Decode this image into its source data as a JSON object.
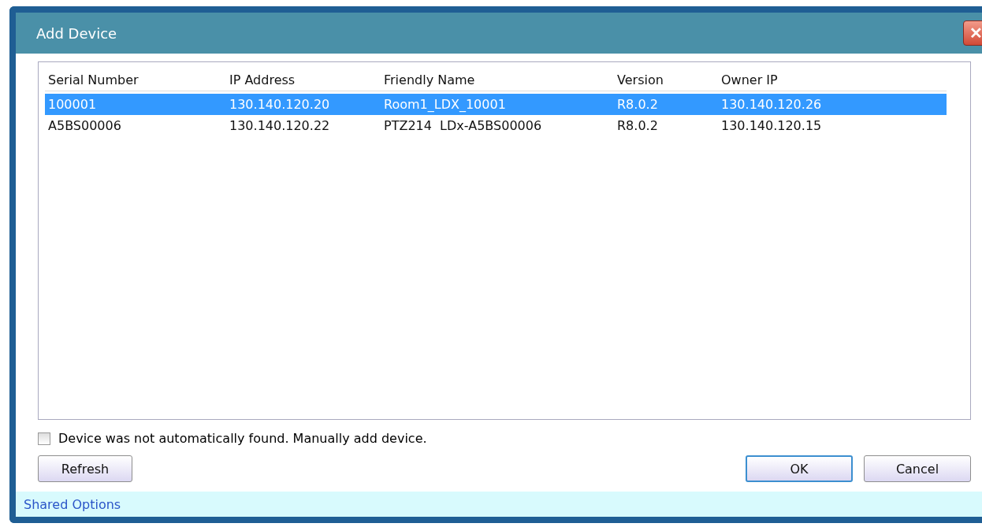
{
  "window": {
    "title": "Add Device",
    "close": "✕"
  },
  "table": {
    "columns": [
      "Serial Number",
      "IP Address",
      "Friendly Name",
      "Version",
      "Owner IP"
    ],
    "rows": [
      {
        "selected": true,
        "cells": [
          "100001",
          "130.140.120.20",
          "Room1_LDX_10001",
          "R8.0.2",
          "130.140.120.26"
        ]
      },
      {
        "selected": false,
        "cells": [
          "A5BS00006",
          "130.140.120.22",
          "PTZ214  LDx-A5BS00006",
          "R8.0.2",
          "130.140.120.15"
        ]
      }
    ]
  },
  "manual": {
    "label": "Device was not automatically found. Manually add device.",
    "checked": false
  },
  "buttons": {
    "refresh": "Refresh",
    "ok": "OK",
    "cancel": "Cancel"
  },
  "footer": {
    "link": "Shared Options"
  }
}
